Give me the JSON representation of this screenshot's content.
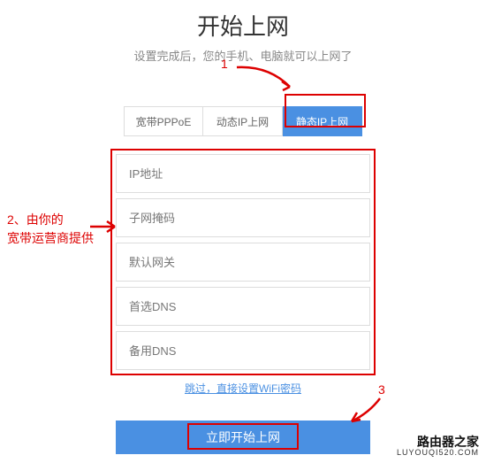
{
  "header": {
    "title": "开始上网",
    "subtitle": "设置完成后，您的手机、电脑就可以上网了"
  },
  "tabs": {
    "items": [
      {
        "label": "宽带PPPoE",
        "active": false
      },
      {
        "label": "动态IP上网",
        "active": false
      },
      {
        "label": "静态IP上网",
        "active": true
      }
    ]
  },
  "form": {
    "fields": [
      {
        "placeholder": "IP地址"
      },
      {
        "placeholder": "子网掩码"
      },
      {
        "placeholder": "默认网关"
      },
      {
        "placeholder": "首选DNS"
      },
      {
        "placeholder": "备用DNS"
      }
    ],
    "skip_label": "跳过，直接设置WiFi密码",
    "submit_label": "立即开始上网"
  },
  "annotations": {
    "a1": "1",
    "a2_line1": "2、由你的",
    "a2_line2": "宽带运营商提供",
    "a3": "3",
    "highlight_color": "#d00"
  },
  "watermark": {
    "main": "路由器之家",
    "sub": "LUYOUQI520.COM"
  }
}
